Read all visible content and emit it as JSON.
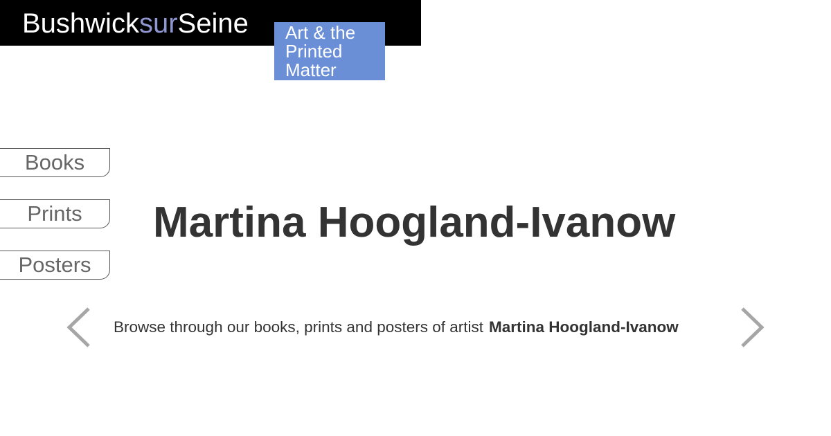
{
  "header": {
    "brand_part1": "Bushwick",
    "brand_part2": "sur",
    "brand_part3": "Seine",
    "tagline": "Art & the\nPrinted\nMatter"
  },
  "nav": {
    "items": [
      {
        "label": "Books"
      },
      {
        "label": "Prints"
      },
      {
        "label": "Posters"
      }
    ]
  },
  "main": {
    "artist_name": "Martina Hoogland-Ivanow",
    "browse_text": "Browse through our books, prints and posters of artist",
    "browse_artist": "Martina Hoogland-Ivanow"
  },
  "carousel": {
    "prev_icon": "chevron-left-icon",
    "next_icon": "chevron-right-icon"
  },
  "colors": {
    "header_bg": "#000000",
    "brand_accent": "#8f96d0",
    "tagline_bg": "#6a8fd6",
    "arrow": "#a6a6a6",
    "title_text": "#333333"
  }
}
